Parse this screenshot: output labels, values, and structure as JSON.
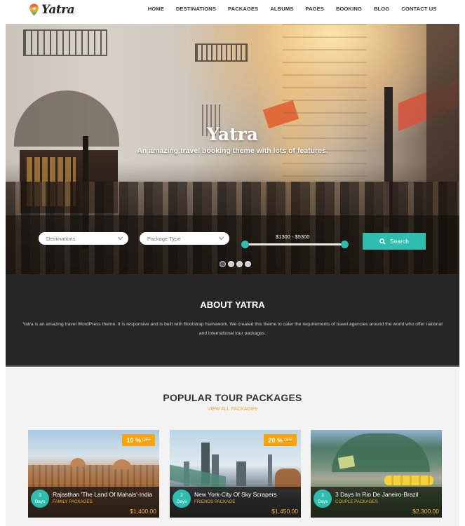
{
  "header": {
    "logo_text": "Yatra",
    "nav": [
      "HOME",
      "DESTINATIONS",
      "PACKAGES",
      "ALBUMS",
      "PAGES",
      "BOOKING",
      "BLOG",
      "CONTACT US"
    ]
  },
  "hero": {
    "title": "Yatra",
    "subtitle": "An amazing travel booking theme with lots of features.",
    "search": {
      "destination_select": "Destinations",
      "package_type_select": "Package Type",
      "price_range_label": "$1300 - $5300",
      "price_min": 1300,
      "price_max": 5300,
      "search_button": "Search"
    },
    "slider": {
      "total_slides": 4,
      "active_slide": 1
    }
  },
  "about": {
    "title": "ABOUT YATRA",
    "text": "Yatra is an amazing travel WordPress theme. It is responsive and is built with Bootstrap framework. We created this theme to cater the requirements of travel agencies around the world who offer national and international tour packages."
  },
  "packages": {
    "title": "POPULAR TOUR PACKAGES",
    "view_all": "VIEW ALL PACKAGES",
    "items": [
      {
        "discount": "10 %",
        "off": "OFF",
        "days_num": "3",
        "days_label": "Days",
        "name": "Rajasthan 'The Land Of Mahals'-India",
        "category": "FAMILY PACKAGES",
        "price": "$1,400.00"
      },
      {
        "discount": "20 %",
        "off": "OFF",
        "days_num": "2",
        "days_label": "Days",
        "name": "New York-City Of Sky Scrapers",
        "category": "FRIENDS PACKAGE",
        "price": "$1,450.00"
      },
      {
        "discount": "",
        "off": "",
        "days_num": "3",
        "days_label": "Days",
        "name": "3 Days In Rio De Janeiro-Brazil",
        "category": "COUPLE PACKAGES",
        "price": "$2,300.00"
      }
    ]
  },
  "colors": {
    "accent_teal": "#2fbdaf",
    "accent_orange": "#f9a30f",
    "dark_section": "#262626",
    "light_section": "#f3f3f3"
  }
}
